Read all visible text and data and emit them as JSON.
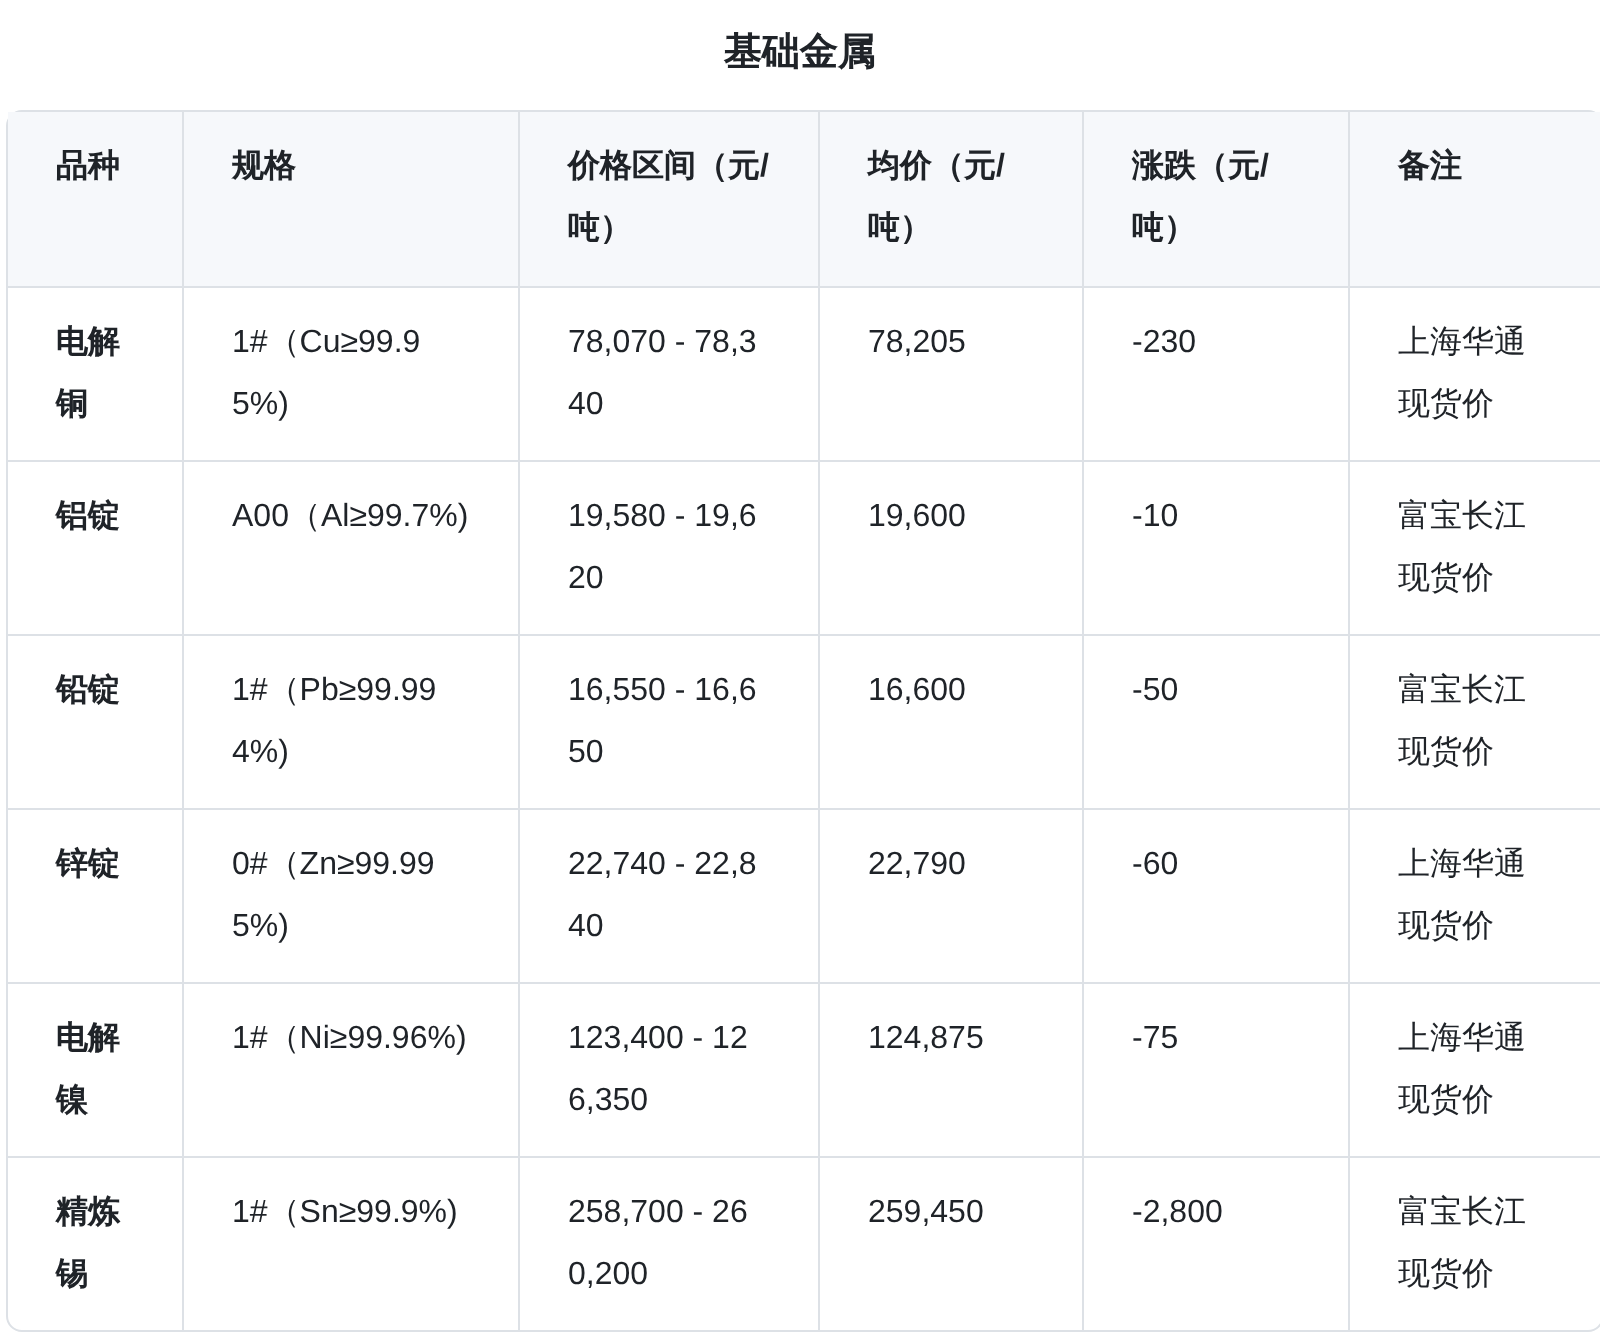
{
  "title": "基础金属",
  "table": {
    "columns": [
      "品种",
      "规格",
      "价格区间（元/吨）",
      "均价（元/吨）",
      "涨跌（元/吨）",
      "备注"
    ],
    "rows": [
      [
        "电解铜",
        "1#（Cu≥99.95%)",
        "78,070 - 78,340",
        "78,205",
        "-230",
        "上海华通现货价"
      ],
      [
        "铝锭",
        "A00（Al≥99.7%)",
        "19,580 - 19,620",
        "19,600",
        "-10",
        "富宝长江现货价"
      ],
      [
        "铅锭",
        "1#（Pb≥99.994%)",
        "16,550 - 16,650",
        "16,600",
        "-50",
        "富宝长江现货价"
      ],
      [
        "锌锭",
        "0#（Zn≥99.995%)",
        "22,740 - 22,840",
        "22,790",
        "-60",
        "上海华通现货价"
      ],
      [
        "电解镍",
        "1#（Ni≥99.96%)",
        "123,400 - 126,350",
        "124,875",
        "-75",
        "上海华通现货价"
      ],
      [
        "精炼锡",
        "1#（Sn≥99.9%)",
        "258,700 - 260,200",
        "259,450",
        "-2,800",
        "富宝长江现货价"
      ]
    ]
  }
}
